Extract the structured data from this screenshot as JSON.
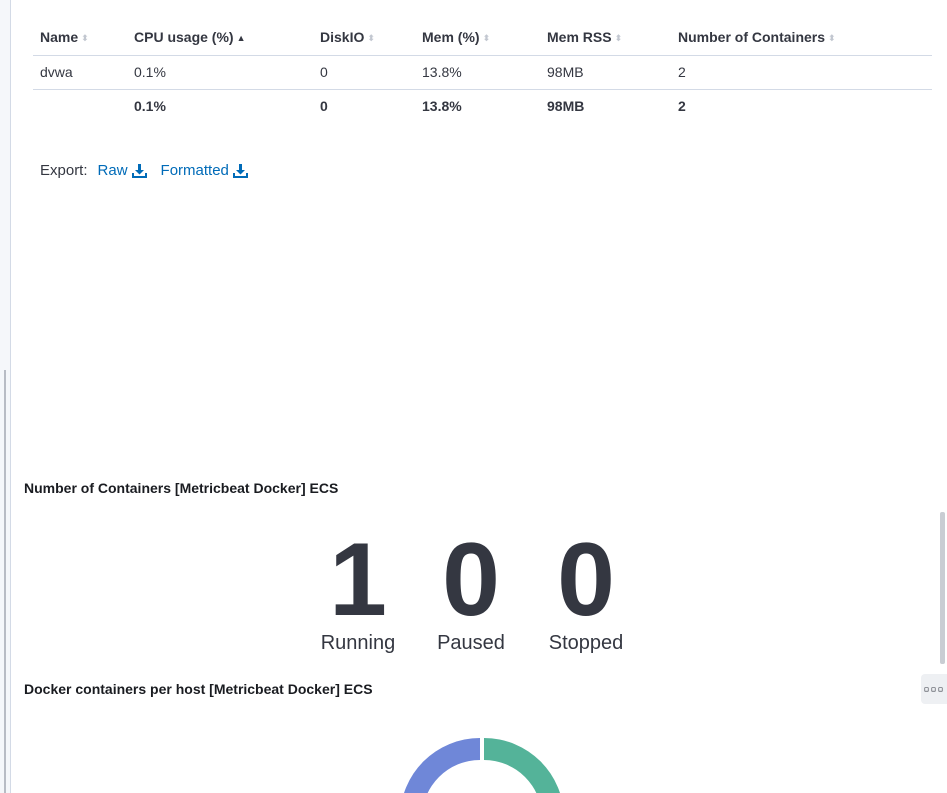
{
  "table": {
    "columns": [
      {
        "label": "Name",
        "sort": "none"
      },
      {
        "label": "CPU usage (%)",
        "sort": "asc"
      },
      {
        "label": "DiskIO",
        "sort": "none"
      },
      {
        "label": "Mem (%)",
        "sort": "none"
      },
      {
        "label": "Mem RSS",
        "sort": "none"
      },
      {
        "label": "Number of Containers",
        "sort": "none"
      }
    ],
    "rows": [
      [
        "dvwa",
        "0.1%",
        "0",
        "13.8%",
        "98MB",
        "2"
      ]
    ],
    "total": [
      "",
      "0.1%",
      "0",
      "13.8%",
      "98MB",
      "2"
    ]
  },
  "export": {
    "label": "Export:",
    "raw_label": "Raw",
    "formatted_label": "Formatted"
  },
  "containers_panel": {
    "title": "Number of Containers [Metricbeat Docker] ECS",
    "metrics": [
      {
        "value": "1",
        "label": "Running"
      },
      {
        "value": "0",
        "label": "Paused"
      },
      {
        "value": "0",
        "label": "Stopped"
      }
    ]
  },
  "hosts_panel": {
    "title": "Docker containers per host [Metricbeat Docker] ECS",
    "colors": {
      "slice_a": "#6f87d8",
      "slice_b": "#54b399"
    }
  }
}
